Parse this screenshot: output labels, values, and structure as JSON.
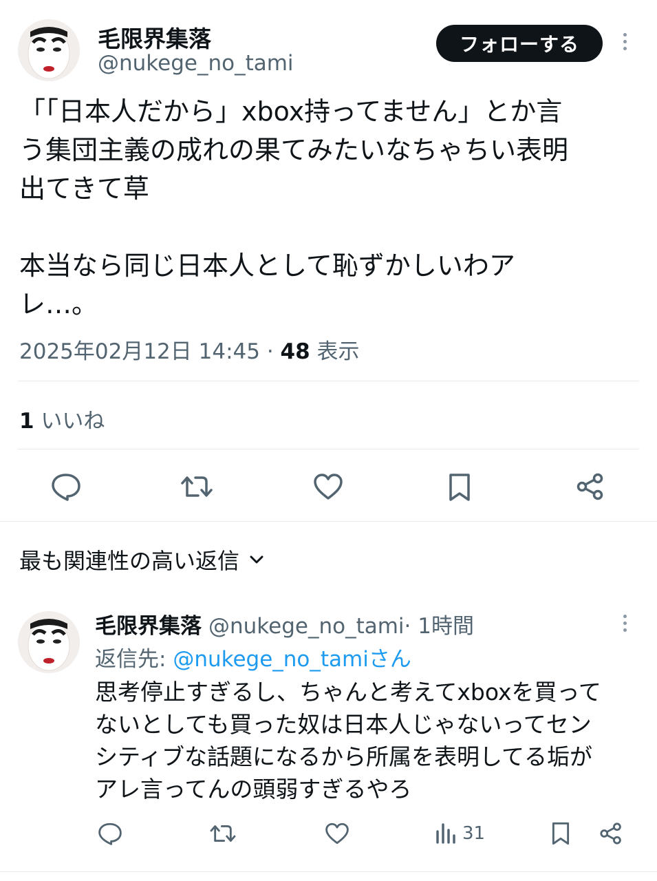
{
  "tweet": {
    "display_name": "毛限界集落",
    "handle": "@nukege_no_tami",
    "follow_label": "フォローする",
    "text": "「「日本人だから」xbox持ってません」とか言\nう集団主義の成れの果てみたいなちゃちい表明\n出てきて草\n\n本当なら同じ日本人として恥ずかしいわア\nレ…。",
    "timestamp": "2025年02月12日 14:45",
    "separator": " · ",
    "views_count": "48",
    "views_label": " 表示",
    "likes_count": "1",
    "likes_label": " いいね"
  },
  "actions": {
    "reply_icon": "reply-icon",
    "retweet_icon": "retweet-icon",
    "like_icon": "heart-icon",
    "bookmark_icon": "bookmark-icon",
    "share_icon": "share-icon"
  },
  "replies_section": {
    "sort_label": "最も関連性の高い返信"
  },
  "reply": {
    "display_name": "毛限界集落",
    "handle": "@nukege_no_tami",
    "time": " · 1時間",
    "reply_to_prefix": "返信先: ",
    "reply_to_mention": "@nukege_no_tamiさん",
    "text": "思考停止すぎるし、ちゃんと考えてxboxを買って\nないとしても買った奴は日本人じゃないってセン\nシティブな話題になるから所属を表明してる垢が\nアレ言ってんの頭弱すぎるやろ",
    "views": "31"
  },
  "colors": {
    "accent": "#1d9bf0",
    "text_primary": "#0f1419",
    "text_secondary": "#536471"
  }
}
